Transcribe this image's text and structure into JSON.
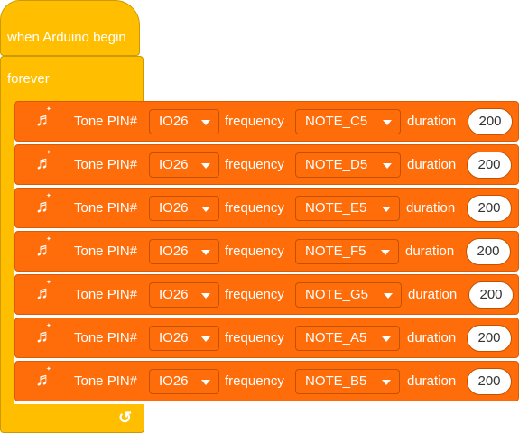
{
  "hat_block": {
    "label": "when Arduino begin"
  },
  "forever_block": {
    "label": "forever",
    "icon": "loop-arrow-icon"
  },
  "tone_blocks": [
    {
      "label": "Tone PIN#",
      "pin": "IO26",
      "freq_label": "frequency",
      "note": "NOTE_C5",
      "dur_label": "duration",
      "duration": "200"
    },
    {
      "label": "Tone PIN#",
      "pin": "IO26",
      "freq_label": "frequency",
      "note": "NOTE_D5",
      "dur_label": "duration",
      "duration": "200"
    },
    {
      "label": "Tone PIN#",
      "pin": "IO26",
      "freq_label": "frequency",
      "note": "NOTE_E5",
      "dur_label": "duration",
      "duration": "200"
    },
    {
      "label": "Tone PIN#",
      "pin": "IO26",
      "freq_label": "frequency",
      "note": "NOTE_F5",
      "dur_label": "duration",
      "duration": "200"
    },
    {
      "label": "Tone PIN#",
      "pin": "IO26",
      "freq_label": "frequency",
      "note": "NOTE_G5",
      "dur_label": "duration",
      "duration": "200"
    },
    {
      "label": "Tone PIN#",
      "pin": "IO26",
      "freq_label": "frequency",
      "note": "NOTE_A5",
      "dur_label": "duration",
      "duration": "200"
    },
    {
      "label": "Tone PIN#",
      "pin": "IO26",
      "freq_label": "frequency",
      "note": "NOTE_B5",
      "dur_label": "duration",
      "duration": "200"
    }
  ],
  "colors": {
    "event": "#ffbf00",
    "tone": "#ff6d0a"
  }
}
